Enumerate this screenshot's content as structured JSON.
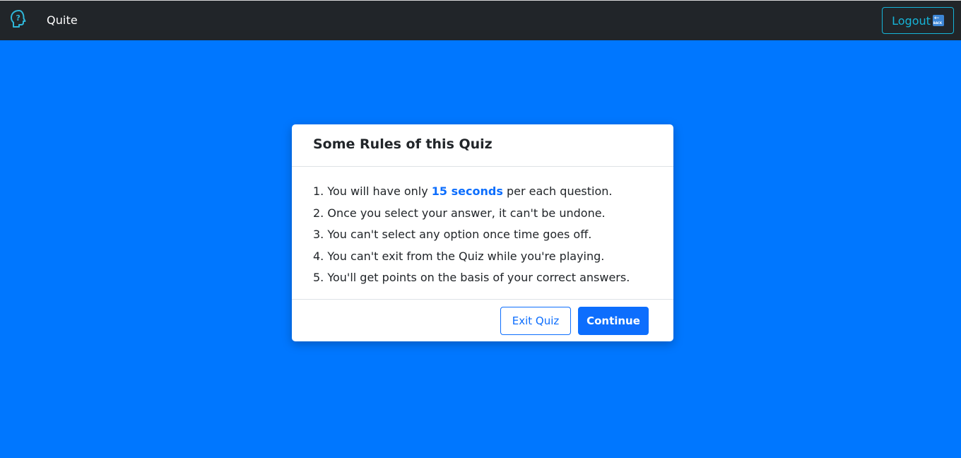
{
  "navbar": {
    "brand_name": "Quite",
    "brand_icon": "question-head-icon",
    "logout_label": "Logout",
    "logout_icon": "back-icon",
    "logout_icon_text": "BACK",
    "accent_color": "#16b4d8"
  },
  "modal": {
    "title": "Some Rules of this Quiz",
    "rules": [
      {
        "prefix": "1. You will have only ",
        "highlight": "15 seconds",
        "suffix": " per each question."
      },
      {
        "text": "2. Once you select your answer, it can't be undone."
      },
      {
        "text": "3. You can't select any option once time goes off."
      },
      {
        "text": "4. You can't exit from the Quiz while you're playing."
      },
      {
        "text": "5. You'll get points on the basis of your correct answers."
      }
    ],
    "exit_label": "Exit Quiz",
    "continue_label": "Continue"
  },
  "colors": {
    "background": "#0077ff",
    "navbar": "#212529",
    "primary": "#0d6efd"
  }
}
